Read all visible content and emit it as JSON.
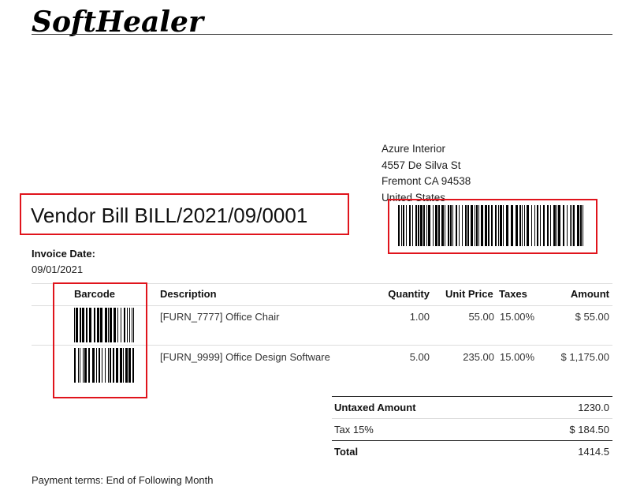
{
  "logo": {
    "text": "SoftHealer"
  },
  "vendor_address": {
    "name": "Azure Interior",
    "street": "4557 De Silva St",
    "city_line": "Fremont CA 94538",
    "country": "United States"
  },
  "document": {
    "title": "Vendor Bill BILL/2021/09/0001",
    "invoice_date_label": "Invoice Date:",
    "invoice_date": "09/01/2021"
  },
  "lines_table": {
    "headers": {
      "barcode": "Barcode",
      "description": "Description",
      "quantity": "Quantity",
      "unit_price": "Unit Price",
      "taxes": "Taxes",
      "amount": "Amount"
    },
    "rows": [
      {
        "description": "[FURN_7777] Office Chair",
        "quantity": "1.00",
        "unit_price": "55.00",
        "taxes": "15.00%",
        "amount": "$ 55.00"
      },
      {
        "description": "[FURN_9999] Office Design Software",
        "quantity": "5.00",
        "unit_price": "235.00",
        "taxes": "15.00%",
        "amount": "$ 1,175.00"
      }
    ]
  },
  "totals": {
    "untaxed_label": "Untaxed Amount",
    "untaxed_value": "1230.0",
    "tax_label": "Tax 15%",
    "tax_value": "$ 184.50",
    "total_label": "Total",
    "total_value": "1414.5"
  },
  "footer": {
    "payment_terms": "Payment terms: End of Following Month"
  },
  "colors": {
    "annotation_box": "#e0141c",
    "text": "#222222",
    "rule": "#333333"
  }
}
